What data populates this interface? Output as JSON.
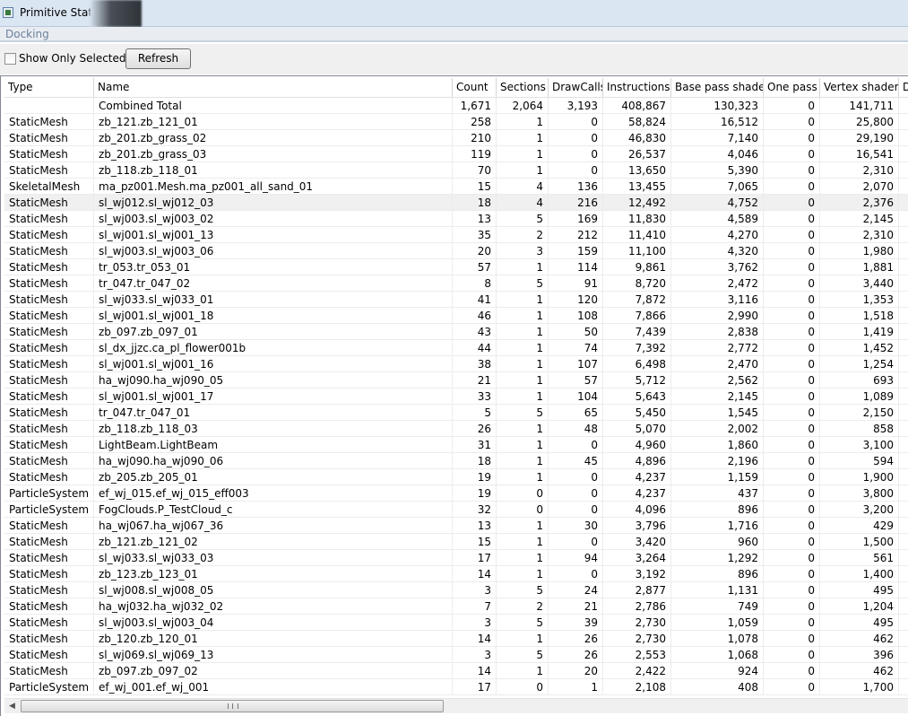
{
  "window": {
    "title": "Primitive Stats"
  },
  "docking": {
    "label": "Docking"
  },
  "toolbar": {
    "show_only_selected_label": "Show Only Selected",
    "refresh_label": "Refresh"
  },
  "table": {
    "columns": [
      "Type",
      "Name",
      "Count",
      "Sections",
      "DrawCalls",
      "Instructions",
      "Base pass shader",
      "One pass",
      "Vertex shader",
      "D"
    ],
    "rows": [
      [
        "",
        "Combined Total",
        "1,671",
        "2,064",
        "3,193",
        "408,867",
        "130,323",
        "0",
        "141,711"
      ],
      [
        "StaticMesh",
        "zb_121.zb_121_01",
        "258",
        "1",
        "0",
        "58,824",
        "16,512",
        "0",
        "25,800"
      ],
      [
        "StaticMesh",
        "zb_201.zb_grass_02",
        "210",
        "1",
        "0",
        "46,830",
        "7,140",
        "0",
        "29,190"
      ],
      [
        "StaticMesh",
        "zb_201.zb_grass_03",
        "119",
        "1",
        "0",
        "26,537",
        "4,046",
        "0",
        "16,541"
      ],
      [
        "StaticMesh",
        "zb_118.zb_118_01",
        "70",
        "1",
        "0",
        "13,650",
        "5,390",
        "0",
        "2,310"
      ],
      [
        "SkeletalMesh",
        "ma_pz001.Mesh.ma_pz001_all_sand_01",
        "15",
        "4",
        "136",
        "13,455",
        "7,065",
        "0",
        "2,070"
      ],
      [
        "StaticMesh",
        "sl_wj012.sl_wj012_03",
        "18",
        "4",
        "216",
        "12,492",
        "4,752",
        "0",
        "2,376"
      ],
      [
        "StaticMesh",
        "sl_wj003.sl_wj003_02",
        "13",
        "5",
        "169",
        "11,830",
        "4,589",
        "0",
        "2,145"
      ],
      [
        "StaticMesh",
        "sl_wj001.sl_wj001_13",
        "35",
        "2",
        "212",
        "11,410",
        "4,270",
        "0",
        "2,310"
      ],
      [
        "StaticMesh",
        "sl_wj003.sl_wj003_06",
        "20",
        "3",
        "159",
        "11,100",
        "4,320",
        "0",
        "1,980"
      ],
      [
        "StaticMesh",
        "tr_053.tr_053_01",
        "57",
        "1",
        "114",
        "9,861",
        "3,762",
        "0",
        "1,881"
      ],
      [
        "StaticMesh",
        "tr_047.tr_047_02",
        "8",
        "5",
        "91",
        "8,720",
        "2,472",
        "0",
        "3,440"
      ],
      [
        "StaticMesh",
        "sl_wj033.sl_wj033_01",
        "41",
        "1",
        "120",
        "7,872",
        "3,116",
        "0",
        "1,353"
      ],
      [
        "StaticMesh",
        "sl_wj001.sl_wj001_18",
        "46",
        "1",
        "108",
        "7,866",
        "2,990",
        "0",
        "1,518"
      ],
      [
        "StaticMesh",
        "zb_097.zb_097_01",
        "43",
        "1",
        "50",
        "7,439",
        "2,838",
        "0",
        "1,419"
      ],
      [
        "StaticMesh",
        "sl_dx_jjzc.ca_pl_flower001b",
        "44",
        "1",
        "74",
        "7,392",
        "2,772",
        "0",
        "1,452"
      ],
      [
        "StaticMesh",
        "sl_wj001.sl_wj001_16",
        "38",
        "1",
        "107",
        "6,498",
        "2,470",
        "0",
        "1,254"
      ],
      [
        "StaticMesh",
        "ha_wj090.ha_wj090_05",
        "21",
        "1",
        "57",
        "5,712",
        "2,562",
        "0",
        "693"
      ],
      [
        "StaticMesh",
        "sl_wj001.sl_wj001_17",
        "33",
        "1",
        "104",
        "5,643",
        "2,145",
        "0",
        "1,089"
      ],
      [
        "StaticMesh",
        "tr_047.tr_047_01",
        "5",
        "5",
        "65",
        "5,450",
        "1,545",
        "0",
        "2,150"
      ],
      [
        "StaticMesh",
        "zb_118.zb_118_03",
        "26",
        "1",
        "48",
        "5,070",
        "2,002",
        "0",
        "858"
      ],
      [
        "StaticMesh",
        "LightBeam.LightBeam",
        "31",
        "1",
        "0",
        "4,960",
        "1,860",
        "0",
        "3,100"
      ],
      [
        "StaticMesh",
        "ha_wj090.ha_wj090_06",
        "18",
        "1",
        "45",
        "4,896",
        "2,196",
        "0",
        "594"
      ],
      [
        "StaticMesh",
        "zb_205.zb_205_01",
        "19",
        "1",
        "0",
        "4,237",
        "1,159",
        "0",
        "1,900"
      ],
      [
        "ParticleSystem",
        "ef_wj_015.ef_wj_015_eff003",
        "19",
        "0",
        "0",
        "4,237",
        "437",
        "0",
        "3,800"
      ],
      [
        "ParticleSystem",
        "FogClouds.P_TestCloud_c",
        "32",
        "0",
        "0",
        "4,096",
        "896",
        "0",
        "3,200"
      ],
      [
        "StaticMesh",
        "ha_wj067.ha_wj067_36",
        "13",
        "1",
        "30",
        "3,796",
        "1,716",
        "0",
        "429"
      ],
      [
        "StaticMesh",
        "zb_121.zb_121_02",
        "15",
        "1",
        "0",
        "3,420",
        "960",
        "0",
        "1,500"
      ],
      [
        "StaticMesh",
        "sl_wj033.sl_wj033_03",
        "17",
        "1",
        "94",
        "3,264",
        "1,292",
        "0",
        "561"
      ],
      [
        "StaticMesh",
        "zb_123.zb_123_01",
        "14",
        "1",
        "0",
        "3,192",
        "896",
        "0",
        "1,400"
      ],
      [
        "StaticMesh",
        "sl_wj008.sl_wj008_05",
        "3",
        "5",
        "24",
        "2,877",
        "1,131",
        "0",
        "495"
      ],
      [
        "StaticMesh",
        "ha_wj032.ha_wj032_02",
        "7",
        "2",
        "21",
        "2,786",
        "749",
        "0",
        "1,204"
      ],
      [
        "StaticMesh",
        "sl_wj003.sl_wj003_04",
        "3",
        "5",
        "39",
        "2,730",
        "1,059",
        "0",
        "495"
      ],
      [
        "StaticMesh",
        "zb_120.zb_120_01",
        "14",
        "1",
        "26",
        "2,730",
        "1,078",
        "0",
        "462"
      ],
      [
        "StaticMesh",
        "sl_wj069.sl_wj069_13",
        "3",
        "5",
        "26",
        "2,553",
        "1,068",
        "0",
        "396"
      ],
      [
        "StaticMesh",
        "zb_097.zb_097_02",
        "14",
        "1",
        "20",
        "2,422",
        "924",
        "0",
        "462"
      ],
      [
        "ParticleSystem",
        "ef_wj_001.ef_wj_001",
        "17",
        "0",
        "1",
        "2,108",
        "408",
        "0",
        "1,700"
      ]
    ],
    "selected_row_index": 6
  },
  "scrollbar": {
    "grip_label": "III"
  }
}
